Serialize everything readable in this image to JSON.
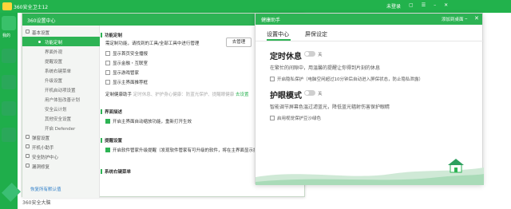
{
  "main_app": {
    "title": "360安全卫士12",
    "title_badge": "✓",
    "user_items": [
      "未登录",
      "▢",
      "☰",
      "–",
      "✕"
    ],
    "left_tab_label": "我的"
  },
  "settings_window": {
    "title": "360设置中心",
    "nav": [
      {
        "label": "基本设置",
        "expanded": true
      },
      {
        "label": "功能定制",
        "sub": true,
        "active": true
      },
      {
        "label": "界面外观",
        "sub": true
      },
      {
        "label": "提醒设置",
        "sub": true
      },
      {
        "label": "系统右键菜单",
        "sub": true
      },
      {
        "label": "升级设置",
        "sub": true
      },
      {
        "label": "开机启动项设置",
        "sub": true
      },
      {
        "label": "用户体验改善计划",
        "sub": true
      },
      {
        "label": "安全云计划",
        "sub": true
      },
      {
        "label": "其他安全设置",
        "sub": true
      },
      {
        "label": "开启 Defender",
        "sub": true
      },
      {
        "label": "弹窗设置"
      },
      {
        "label": "开机小助手"
      },
      {
        "label": "安全防护中心"
      },
      {
        "label": "漏洞修复"
      }
    ],
    "footer_link": "恢复所有默认值",
    "content": {
      "section1_title": "功能定制",
      "section1_desc": "需定制功能，请找到的工具/全部工具中进行管理",
      "manage_btn": "去管理",
      "options": [
        {
          "label": "显示首页安全播报",
          "checked": false
        },
        {
          "label": "显示金融・互联室",
          "checked": false
        },
        {
          "label": "显示游戏管家",
          "checked": false
        },
        {
          "label": "显示主界面推荐框",
          "checked": false
        }
      ],
      "health_row_label": "定制健康助手",
      "health_row_grey": "定时休息、护护身心健康：防蓝光保护、提醒眼健康",
      "health_row_link": "去设置",
      "section2_title": "界面描述",
      "section2_option": "开启主界面自动缩放功能，重新打开生效",
      "section3_title": "提醒设置",
      "section3_option": "开启软件管家升级提醒（发现软件管家有可升级的软件，将在主界面显示提醒）",
      "section4_title": "系统右键菜单"
    }
  },
  "brand": {
    "name": "360安全大脑"
  },
  "health_assistant": {
    "title": "健康助手",
    "add_to_desktop": "添加到桌面",
    "minimize": "–",
    "close": "✕",
    "tabs": [
      "设置中心",
      "屏保设定"
    ],
    "break": {
      "title": "定时休息",
      "toggle_state": "关",
      "desc": "在繁忙的间隙中，用温馨的提醒让你得到片刻的休息",
      "option": "开启隐私保护（电脑空闲超过10分钟后自动进入屏保状态，防止隐私泄露）"
    },
    "eye": {
      "title": "护眼模式",
      "toggle_state": "关",
      "desc": "智能调节屏幕色温过滤蓝光，降低蓝光辐射伤害保护眼睛",
      "option": "启用视觉保护豆沙绿色"
    }
  }
}
